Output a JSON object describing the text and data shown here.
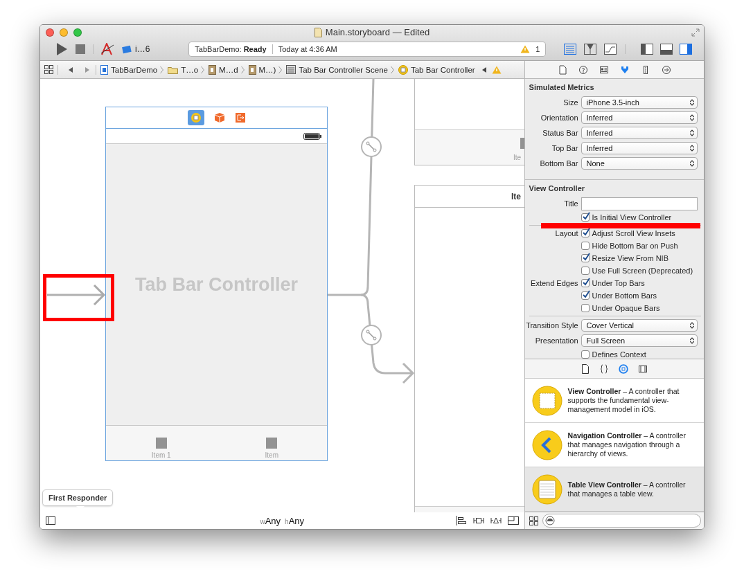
{
  "window": {
    "title": "Main.storyboard — Edited"
  },
  "toolbar": {
    "scheme": "i…6",
    "activity": {
      "project": "TabBarDemo:",
      "state": "Ready",
      "time": "Today at 4:36 AM",
      "warning_count": "1"
    },
    "editor_modes": [
      {
        "kind": "standard",
        "selected": true
      },
      {
        "kind": "assistant",
        "selected": false
      },
      {
        "kind": "version",
        "selected": false
      }
    ],
    "view_toggles": [
      {
        "kind": "navigator",
        "selected": false
      },
      {
        "kind": "debug",
        "selected": false
      },
      {
        "kind": "utilities",
        "selected": true
      }
    ]
  },
  "jump_bar": {
    "items": [
      {
        "kind": "project",
        "label": "TabBarDemo"
      },
      {
        "kind": "folder",
        "label": "T…o"
      },
      {
        "kind": "file",
        "label": "M…d"
      },
      {
        "kind": "file",
        "label": "M…)"
      },
      {
        "kind": "scene",
        "label": "Tab Bar Controller Scene"
      },
      {
        "kind": "controller",
        "label": "Tab Bar Controller"
      }
    ]
  },
  "canvas": {
    "tab_bar_scene": {
      "title": "Tab Bar Controller",
      "tab_items": [
        "Item 1",
        "Item"
      ]
    },
    "entry_point": {
      "highlighted": true
    },
    "child_scenes": [
      {
        "tab_item": "Ite"
      },
      {
        "title": "Ite"
      }
    ],
    "first_responder": "First Responder",
    "size_class": [
      {
        "axis": "w",
        "value": "Any"
      },
      {
        "axis": "h",
        "value": "Any"
      }
    ]
  },
  "inspector": {
    "tabs": [
      {
        "kind": "file",
        "selected": false
      },
      {
        "kind": "help",
        "selected": false
      },
      {
        "kind": "identity",
        "selected": false
      },
      {
        "kind": "attributes",
        "selected": true
      },
      {
        "kind": "size",
        "selected": false
      },
      {
        "kind": "connections",
        "selected": false
      }
    ],
    "sections": [
      {
        "title": "Simulated Metrics",
        "rows": [
          {
            "kind": "popup",
            "label": "Size",
            "value": "iPhone 3.5-inch"
          },
          {
            "kind": "popup",
            "label": "Orientation",
            "value": "Inferred"
          },
          {
            "kind": "popup",
            "label": "Status Bar",
            "value": "Inferred"
          },
          {
            "kind": "popup",
            "label": "Top Bar",
            "value": "Inferred"
          },
          {
            "kind": "popup",
            "label": "Bottom Bar",
            "value": "None"
          }
        ]
      },
      {
        "title": "View Controller",
        "rows": [
          {
            "kind": "text",
            "label": "Title"
          },
          {
            "kind": "checkbox",
            "text": "Is Initial View Controller",
            "checked": true,
            "highlighted": true
          },
          {
            "kind": "separator"
          },
          {
            "kind": "checkbox",
            "label": "Layout",
            "text": "Adjust Scroll View Insets",
            "checked": true
          },
          {
            "kind": "checkbox",
            "text": "Hide Bottom Bar on Push",
            "checked": false
          },
          {
            "kind": "checkbox",
            "text": "Resize View From NIB",
            "checked": true
          },
          {
            "kind": "checkbox",
            "text": "Use Full Screen (Deprecated)",
            "checked": false
          },
          {
            "kind": "checkbox",
            "label": "Extend Edges",
            "text": "Under Top Bars",
            "checked": true
          },
          {
            "kind": "checkbox",
            "text": "Under Bottom Bars",
            "checked": true
          },
          {
            "kind": "checkbox",
            "text": "Under Opaque Bars",
            "checked": false
          },
          {
            "kind": "separator"
          },
          {
            "kind": "popup",
            "label": "Transition Style",
            "value": "Cover Vertical"
          },
          {
            "kind": "popup",
            "label": "Presentation",
            "value": "Full Screen"
          },
          {
            "kind": "checkbox",
            "text": "Defines Context",
            "checked": false
          }
        ]
      }
    ]
  },
  "library": {
    "tabs": [
      {
        "kind": "file",
        "selected": false
      },
      {
        "kind": "code",
        "selected": false
      },
      {
        "kind": "object",
        "selected": true
      },
      {
        "kind": "media",
        "selected": false
      }
    ],
    "items": [
      {
        "kind": "view",
        "text": "**View Controller** – A controller that supports the fundamental view-management model in iOS.",
        "selected": false
      },
      {
        "kind": "navigation",
        "text": "**Navigation Controller** – A controller that manages navigation through a hierarchy of views.",
        "selected": false
      },
      {
        "kind": "table",
        "text": "**Table View Controller** – A controller that manages a table view.",
        "selected": true
      }
    ]
  }
}
